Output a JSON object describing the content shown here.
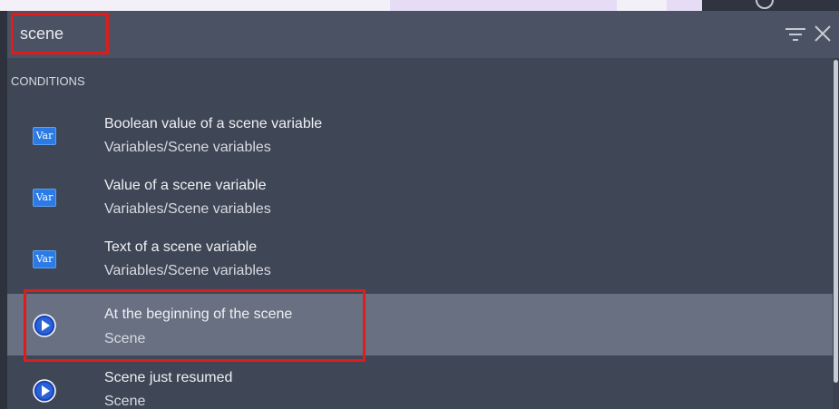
{
  "search": {
    "value": "scene"
  },
  "section": {
    "header": "CONDITIONS"
  },
  "items": [
    {
      "title": "Boolean value of a scene variable",
      "subtitle": "Variables/Scene variables",
      "icon": "var-icon",
      "icon_label": "Var"
    },
    {
      "title": "Value of a scene variable",
      "subtitle": "Variables/Scene variables",
      "icon": "var-icon",
      "icon_label": "Var"
    },
    {
      "title": "Text of a scene variable",
      "subtitle": "Variables/Scene variables",
      "icon": "var-icon",
      "icon_label": "Var"
    },
    {
      "title": "At the beginning of the scene",
      "subtitle": "Scene",
      "icon": "play-icon",
      "selected": true
    },
    {
      "title": "Scene just resumed",
      "subtitle": "Scene",
      "icon": "play-icon"
    }
  ],
  "colors": {
    "panel_bg": "#3f4655",
    "search_bg": "#4a5263",
    "selected_row": "#687082",
    "highlight_border": "#e01b1b",
    "var_icon_blue": "#2a7be6"
  }
}
